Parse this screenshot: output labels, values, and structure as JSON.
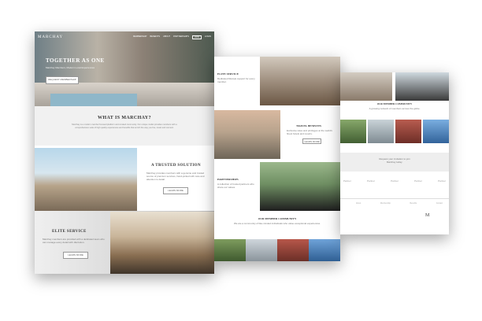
{
  "page1": {
    "logo": "MARCHAY",
    "nav": [
      "MEMBERSHIP",
      "BENEFITS",
      "ABOUT",
      "PARTNERSHIPS",
      "JOIN",
      "LOGIN"
    ],
    "hero_title": "TOGETHER AS ONE",
    "hero_subtitle": "Marchay Members, Modern Local Experiences",
    "hero_button": "REQUEST MEMBERSHIP",
    "what_title": "WHAT IS MARCHAY?",
    "what_text": "Marchay is a modern member focused platform and curated community. Our unique model provides members with a comprehensive suite of high quality experiences and benefits that enrich the way you live, travel and connect.",
    "trusted_title": "A TRUSTED SOLUTION",
    "trusted_text": "Marchay provides members with a genuine and trusted source of premium services, hand-picked with care and attention to detail.",
    "trusted_button": "LEARN MORE",
    "elite_title": "ELITE SERVICE",
    "elite_text": "Marchay members are provided with a dedicated team who can manage every detail with discretion.",
    "elite_button": "LEARN MORE"
  },
  "page2": {
    "elite_title": "ELITE SERVICE",
    "elite_text": "Dedicated lifestyle support for every member.",
    "travel_title": "TRAVEL BENEFITS",
    "travel_text": "Exclusive rates and privileges at the world's finest hotels and resorts.",
    "travel_button": "LEARN MORE",
    "partnerships_title": "PARTNERSHIPS",
    "partnerships_text": "A collection of trusted partners who share our values.",
    "member_title": "OUR MEMBER COMMUNITY",
    "member_text": "We are a community of like-minded individuals who value exceptional experiences."
  },
  "page3": {
    "member_title": "OUR MEMBER COMMUNITY",
    "member_text": "A growing network of members across the globe.",
    "cta_text": "Request your invitation to join Marchay today.",
    "partners": [
      "Partner",
      "Partner",
      "Partner",
      "Partner",
      "Partner"
    ],
    "footer_links": [
      "About",
      "Membership",
      "Benefits",
      "Contact"
    ],
    "footer_logo": "M"
  }
}
